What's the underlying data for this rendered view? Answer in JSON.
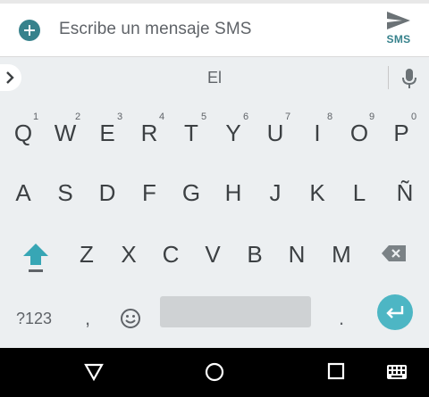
{
  "compose": {
    "placeholder": "Escribe un mensaje SMS",
    "send_label": "SMS",
    "accent_color": "#37828c"
  },
  "suggestions": {
    "word": "El"
  },
  "keyboard": {
    "row1": [
      {
        "letter": "Q",
        "num": "1"
      },
      {
        "letter": "W",
        "num": "2"
      },
      {
        "letter": "E",
        "num": "3"
      },
      {
        "letter": "R",
        "num": "4"
      },
      {
        "letter": "T",
        "num": "5"
      },
      {
        "letter": "Y",
        "num": "6"
      },
      {
        "letter": "U",
        "num": "7"
      },
      {
        "letter": "I",
        "num": "8"
      },
      {
        "letter": "O",
        "num": "9"
      },
      {
        "letter": "P",
        "num": "0"
      }
    ],
    "row2": [
      "A",
      "S",
      "D",
      "F",
      "G",
      "H",
      "J",
      "K",
      "L",
      "Ñ"
    ],
    "row3": [
      "Z",
      "X",
      "C",
      "V",
      "B",
      "N",
      "M"
    ],
    "symbols_label": "?123",
    "comma_label": ",",
    "period_label": ".",
    "shift_icon": "shift-arrow-icon",
    "backspace_icon": "backspace-icon",
    "enter_icon": "enter-icon",
    "enter_color": "#4db6c4",
    "emoji_icon": "emoji-icon"
  },
  "navbar": {
    "back_icon": "back-triangle-icon",
    "home_icon": "home-circle-icon",
    "recents_icon": "recents-square-icon",
    "keyboard_icon": "keyboard-icon"
  }
}
